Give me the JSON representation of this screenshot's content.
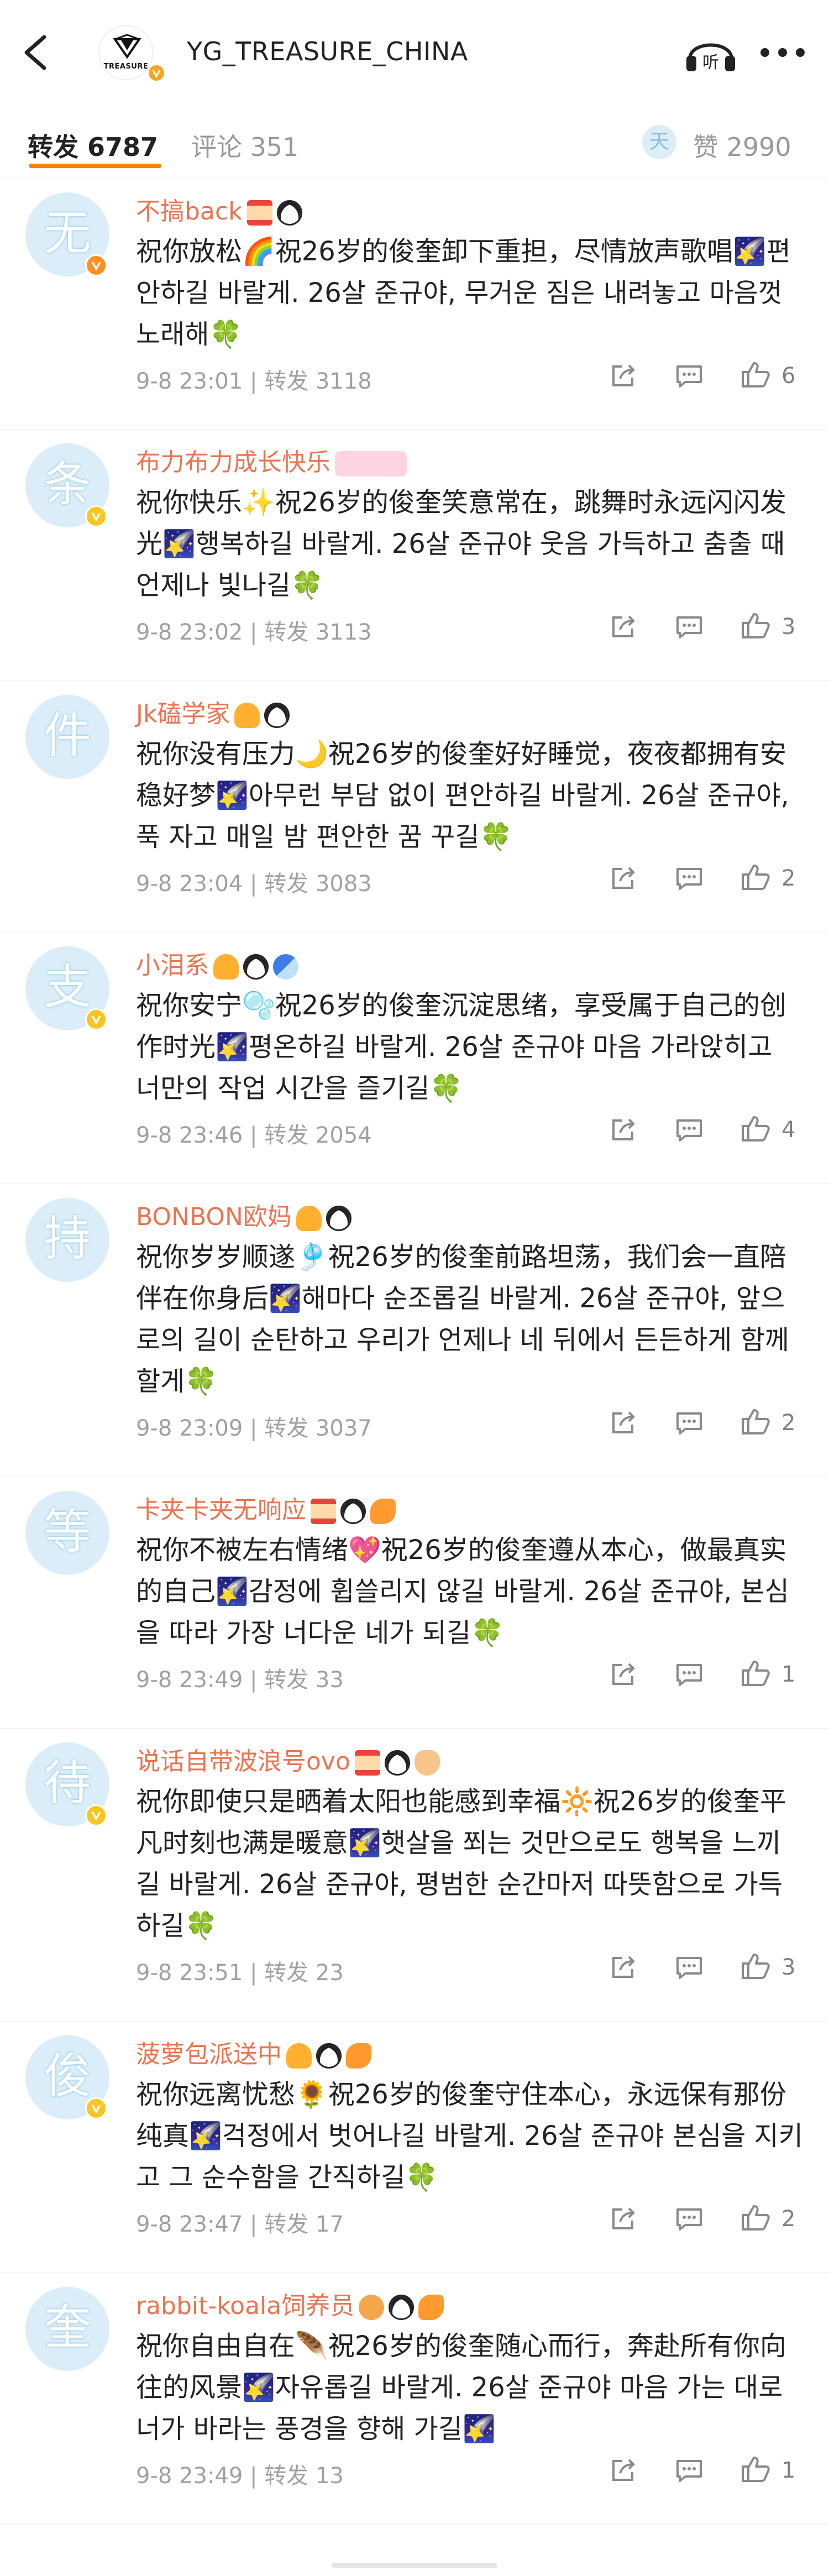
{
  "header": {
    "account_name": "YG_TREASURE_CHINA",
    "logo_text": "TREASURE",
    "back_icon": "chevron-left-icon",
    "listen_icon": "headphone-listen-icon",
    "listen_label": "听",
    "more_icon": "more-dots-icon"
  },
  "tabs": {
    "repost_label": "转发",
    "repost_count": "6787",
    "comment_label": "评论",
    "comment_count": "351",
    "like_label": "赞",
    "like_count": "2990",
    "like_avatar_char": "天"
  },
  "colors": {
    "accent": "#ff8200",
    "username": "#eb7350",
    "meta": "#a0a0a0",
    "avatar_bg": "#daedf8"
  },
  "reposts": [
    {
      "avatar_char": "无",
      "verified": "orange",
      "username": "不搞back",
      "badges": [
        "hourglass-badge",
        "panda-badge"
      ],
      "text": "祝你放松🌈祝26岁的俊奎卸下重担，尽情放声歌唱🌠편안하길 바랄게. 26살 준규야, 무거운 짐은 내려놓고 마음껏 노래해🍀",
      "time": "9-8 23:01",
      "repost_label": "转发",
      "repost_count": "3118",
      "likes": "6"
    },
    {
      "avatar_char": "条",
      "verified": "yellow",
      "username": "布力布力成长快乐",
      "badges": [
        "pink-level-badge"
      ],
      "text": "祝你快乐✨祝26岁的俊奎笑意常在，跳舞时永远闪闪发光🌠행복하길 바랄게. 26살 준규야 웃음 가득하고 춤출 때 언제나 빛나길🍀",
      "time": "9-8 23:02",
      "repost_label": "转发",
      "repost_count": "3113",
      "likes": "3"
    },
    {
      "avatar_char": "件",
      "verified": "none",
      "username": "Jk磕学家",
      "badges": [
        "crown-badge",
        "panda-badge"
      ],
      "text": "祝你没有压力🌙祝26岁的俊奎好好睡觉，夜夜都拥有安稳好梦🌠아무런 부담 없이 편안하길 바랄게. 26살 준규야, 푹 자고 매일 밤 편안한 꿈 꾸길🍀",
      "time": "9-8 23:04",
      "repost_label": "转发",
      "repost_count": "3083",
      "likes": "2"
    },
    {
      "avatar_char": "支",
      "verified": "yellow",
      "username": "小泪系",
      "badges": [
        "crown-badge",
        "panda-badge",
        "wave-badge"
      ],
      "text": "祝你安宁🫧祝26岁的俊奎沉淀思绪，享受属于自己的创作时光🌠평온하길 바랄게. 26살 준규야 마음 가라앉히고 너만의 작업 시간을 즐기길🍀",
      "time": "9-8 23:46",
      "repost_label": "转发",
      "repost_count": "2054",
      "likes": "4"
    },
    {
      "avatar_char": "持",
      "verified": "none",
      "username": "BONBON欧妈",
      "badges": [
        "crown-badge",
        "panda-badge"
      ],
      "text": "祝你岁岁顺遂🎐祝26岁的俊奎前路坦荡，我们会一直陪伴在你身后🌠해마다 순조롭길 바랄게. 26살 준규야, 앞으로의 길이 순탄하고 우리가 언제나 네 뒤에서 든든하게 함께할게🍀",
      "time": "9-8 23:09",
      "repost_label": "转发",
      "repost_count": "3037",
      "likes": "2"
    },
    {
      "avatar_char": "等",
      "verified": "none",
      "username": "卡夹卡夹无响应",
      "badges": [
        "hourglass-badge",
        "panda-badge",
        "fish-badge"
      ],
      "text": "祝你不被左右情绪💖祝26岁的俊奎遵从本心，做最真实的自己🌠감정에 휩쓸리지 않길 바랄게. 26살 준규야, 본심을 따라 가장 너다운 네가 되길🍀",
      "time": "9-8 23:49",
      "repost_label": "转发",
      "repost_count": "33",
      "likes": "1"
    },
    {
      "avatar_char": "待",
      "verified": "yellow",
      "username": "说话自带波浪号ovo",
      "badges": [
        "hourglass-badge",
        "panda-badge",
        "cat-badge"
      ],
      "text": "祝你即使只是晒着太阳也能感到幸福🔆祝26岁的俊奎平凡时刻也满是暖意🌠햇살을 쬐는 것만으로도 행복을 느끼길 바랄게. 26살 준규야, 평범한 순간마저 따뜻함으로 가득하길🍀",
      "time": "9-8 23:51",
      "repost_label": "转发",
      "repost_count": "23",
      "likes": "3"
    },
    {
      "avatar_char": "俊",
      "verified": "yellow",
      "username": "菠萝包派送中",
      "badges": [
        "crown-badge",
        "panda-badge",
        "fish-badge"
      ],
      "text": "祝你远离忧愁🌻祝26岁的俊奎守住本心，永远保有那份纯真🌠걱정에서 벗어나길 바랄게. 26살 준규야 본심을 지키고 그 순수함을 간직하길🍀",
      "time": "9-8 23:47",
      "repost_label": "转发",
      "repost_count": "17",
      "likes": "2"
    },
    {
      "avatar_char": "奎",
      "verified": "none",
      "username": "rabbit-koala饲养员",
      "badges": [
        "bear-badge",
        "panda-badge",
        "fish-badge"
      ],
      "text": "祝你自由自在🪶祝26岁的俊奎随心而行，奔赴所有你向往的风景🌠자유롭길 바랄게. 26살 준규야 마음 가는 대로 너가 바라는 풍경을 향해 가길🌠",
      "time": "9-8 23:49",
      "repost_label": "转发",
      "repost_count": "13",
      "likes": "1"
    }
  ]
}
